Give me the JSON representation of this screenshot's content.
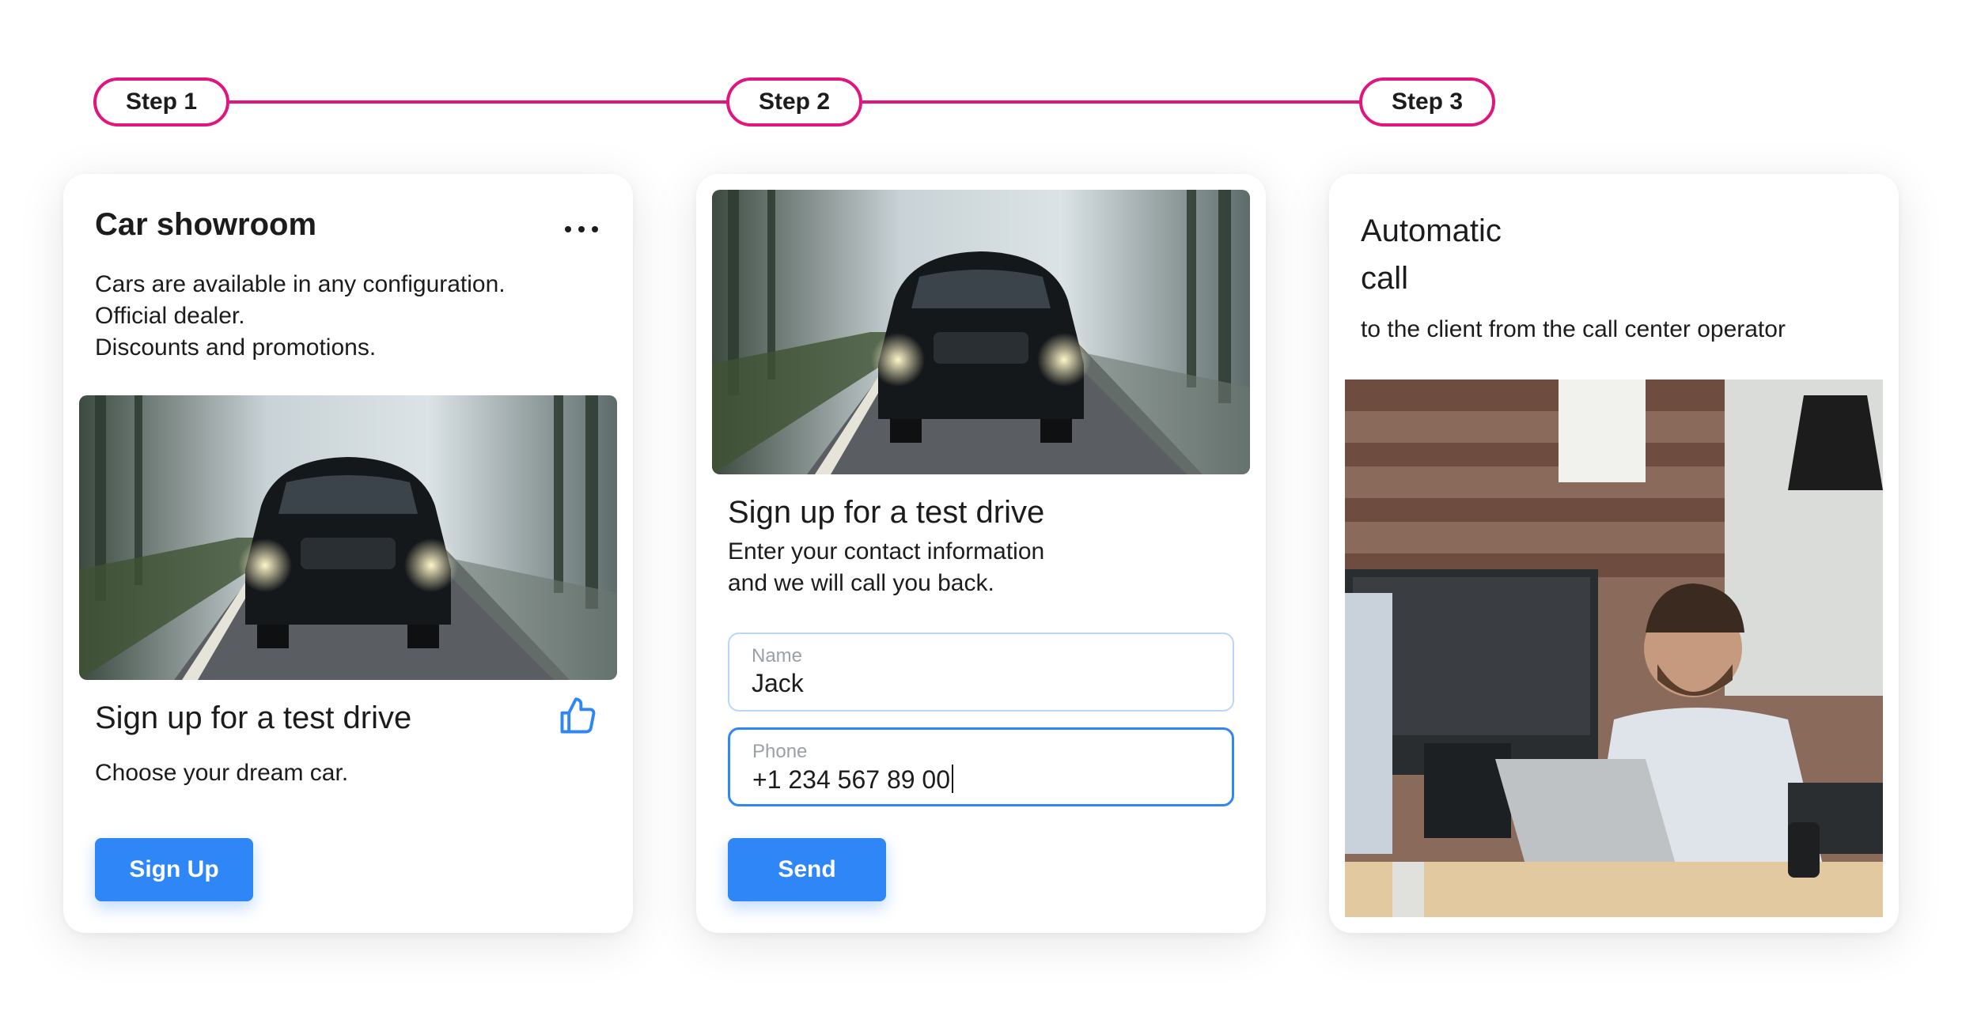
{
  "steps": [
    {
      "label": "Step 1"
    },
    {
      "label": "Step 2"
    },
    {
      "label": "Step 3"
    }
  ],
  "colors": {
    "accent": "#e0157d",
    "primary_button": "#2e86f7"
  },
  "card1": {
    "title": "Car showroom",
    "menu_icon": "more-horizontal-icon",
    "description_lines": [
      "Cars are available in any configuration.",
      "Official dealer.",
      "Discounts and promotions."
    ],
    "image": "car-in-foggy-forest",
    "subtitle": "Sign up for a test drive",
    "like_icon": "thumbs-up-icon",
    "text": "Choose your dream car.",
    "button_label": "Sign Up"
  },
  "card2": {
    "image": "car-in-foggy-forest",
    "subtitle": "Sign up for a test drive",
    "text_lines": [
      "Enter your contact information",
      "and we will call you back."
    ],
    "name_field": {
      "label": "Name",
      "value": "Jack"
    },
    "phone_field": {
      "label": "Phone",
      "value": "+1 234 567 89 00"
    },
    "button_label": "Send"
  },
  "card3": {
    "title_lines": [
      "Automatic",
      "call"
    ],
    "subtitle": "to the client from the call center operator",
    "image": "call-center-operator"
  }
}
